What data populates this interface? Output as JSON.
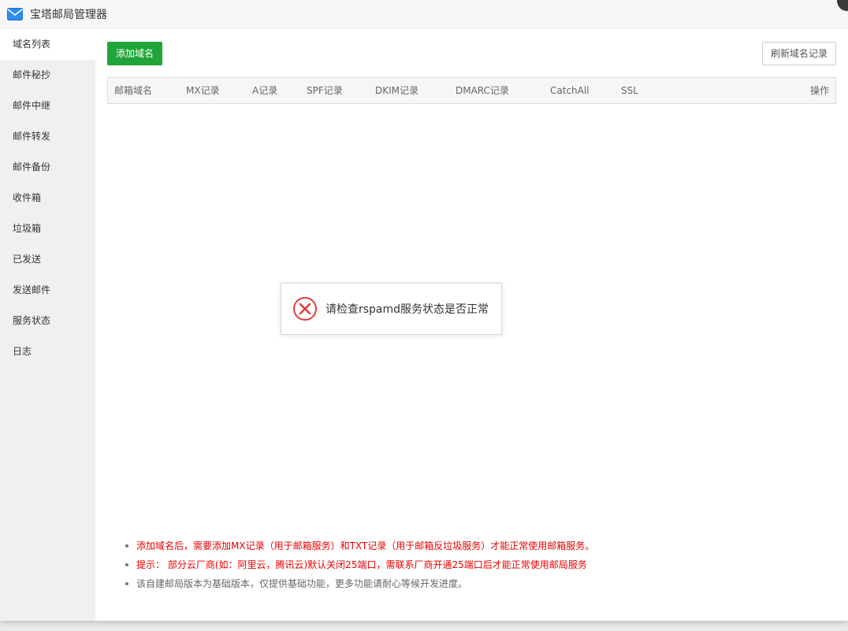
{
  "window": {
    "title": "宝塔邮局管理器",
    "icon": "mail-icon"
  },
  "sidebar": {
    "items": [
      {
        "label": "域名列表",
        "active": true
      },
      {
        "label": "邮件秘抄",
        "active": false
      },
      {
        "label": "邮件中继",
        "active": false
      },
      {
        "label": "邮件转发",
        "active": false
      },
      {
        "label": "邮件备份",
        "active": false
      },
      {
        "label": "收件箱",
        "active": false
      },
      {
        "label": "垃圾箱",
        "active": false
      },
      {
        "label": "已发送",
        "active": false
      },
      {
        "label": "发送邮件",
        "active": false
      },
      {
        "label": "服务状态",
        "active": false
      },
      {
        "label": "日志",
        "active": false
      }
    ]
  },
  "toolbar": {
    "add_label": "添加域名",
    "refresh_label": "刷新域名记录"
  },
  "table": {
    "columns": [
      "邮箱域名",
      "MX记录",
      "A记录",
      "SPF记录",
      "DKIM记录",
      "DMARC记录",
      "CatchAll",
      "SSL",
      "操作"
    ]
  },
  "notes": [
    {
      "text": "添加域名后，需要添加MX记录（用于邮箱服务）和TXT记录（用于邮箱反垃圾服务）才能正常使用邮箱服务。",
      "color": "red"
    },
    {
      "text": "提示： 部分云厂商(如：阿里云，腾讯云)默认关闭25端口，需联系厂商开通25端口后才能正常使用邮局服务",
      "color": "red"
    },
    {
      "text": "该自建邮局版本为基础版本，仅提供基础功能，更多功能请耐心等候开发进度。",
      "color": "gray"
    }
  ],
  "message": {
    "text": "请检查rspamd服务状态是否正常",
    "icon": "error-icon"
  },
  "colors": {
    "accent": "#20a53a",
    "error": "#e23b3b",
    "note_red": "#e60000"
  }
}
